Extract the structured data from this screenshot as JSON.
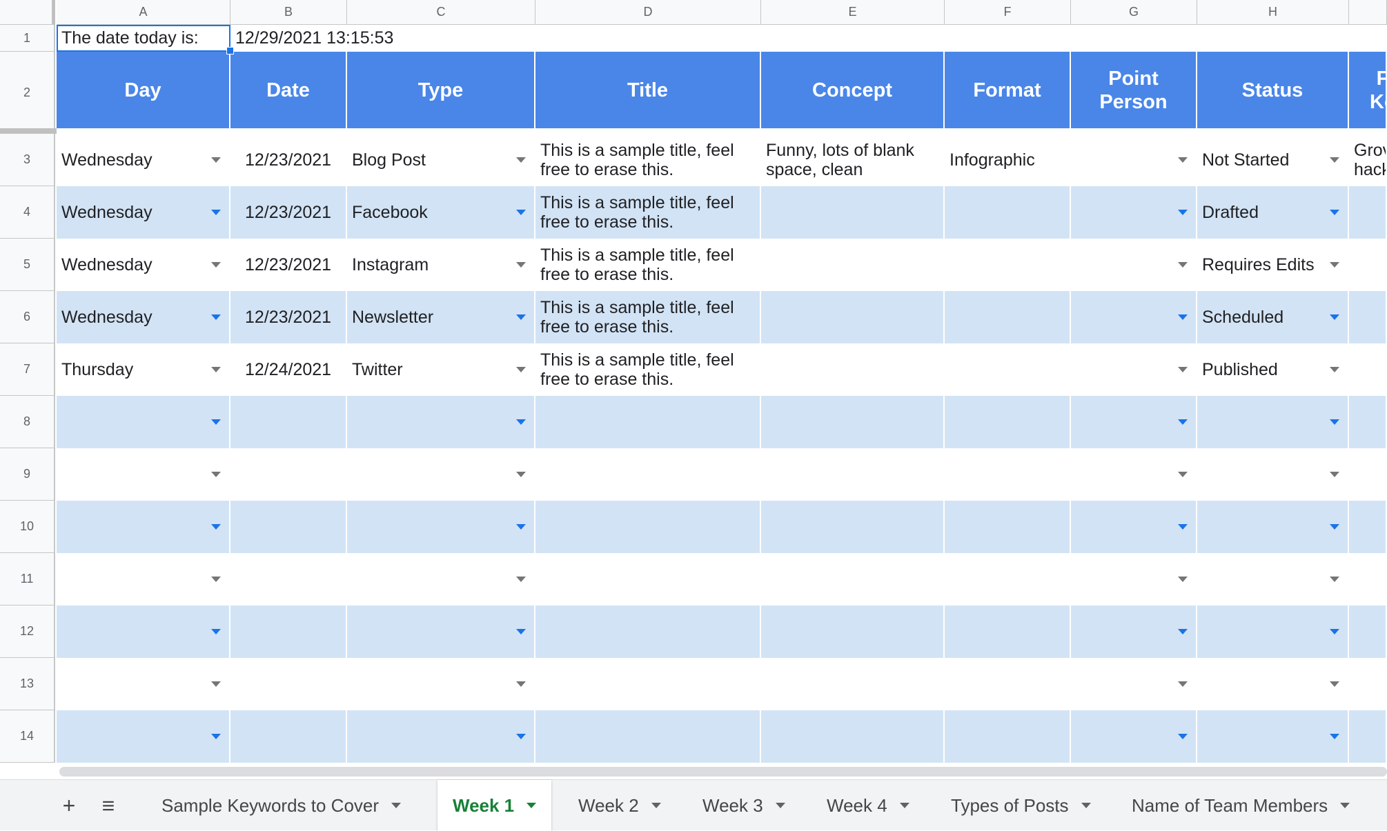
{
  "columns": [
    "A",
    "B",
    "C",
    "D",
    "E",
    "F",
    "G",
    "H"
  ],
  "row1": {
    "label": "The date today is:",
    "value": "12/29/2021 13:15:53"
  },
  "headers": [
    "Day",
    "Date",
    "Type",
    "Title",
    "Concept",
    "Format",
    "Point\nPerson",
    "Status",
    "F\nKe"
  ],
  "rows": [
    {
      "day": "Wednesday",
      "date": "12/23/2021",
      "type": "Blog Post",
      "title": "This is a sample title, feel free to erase this.",
      "concept": "Funny, lots of blank space, clean",
      "format": "Infographic",
      "status": "Not Started",
      "extra": "Grov hack"
    },
    {
      "day": "Wednesday",
      "date": "12/23/2021",
      "type": "Facebook",
      "title": "This is a sample title, feel free to erase this.",
      "concept": "",
      "format": "",
      "status": "Drafted",
      "extra": ""
    },
    {
      "day": "Wednesday",
      "date": "12/23/2021",
      "type": "Instagram",
      "title": "This is a sample title, feel free to erase this.",
      "concept": "",
      "format": "",
      "status": "Requires Edits",
      "extra": ""
    },
    {
      "day": "Wednesday",
      "date": "12/23/2021",
      "type": "Newsletter",
      "title": "This is a sample title, feel free to erase this.",
      "concept": "",
      "format": "",
      "status": "Scheduled",
      "extra": ""
    },
    {
      "day": "Thursday",
      "date": "12/24/2021",
      "type": "Twitter",
      "title": "This is a sample title, feel free to erase this.",
      "concept": "",
      "format": "",
      "status": "Published",
      "extra": ""
    }
  ],
  "row_numbers": [
    "1",
    "2",
    "3",
    "4",
    "5",
    "6",
    "7",
    "8",
    "9",
    "10",
    "11",
    "12",
    "13",
    "14"
  ],
  "tabs": [
    {
      "label": "Sample Keywords to Cover",
      "active": false
    },
    {
      "label": "Week 1",
      "active": true
    },
    {
      "label": "Week 2",
      "active": false
    },
    {
      "label": "Week 3",
      "active": false
    },
    {
      "label": "Week 4",
      "active": false
    },
    {
      "label": "Types of Posts",
      "active": false
    },
    {
      "label": "Name of Team Members",
      "active": false
    }
  ],
  "toolbar": {
    "add_icon": "+",
    "menu_icon": "≡"
  },
  "colors": {
    "header_blue": "#4a86e8",
    "band_blue": "#d2e3f5",
    "active_tab_green": "#188038",
    "caret_blue": "#1a73e8"
  }
}
